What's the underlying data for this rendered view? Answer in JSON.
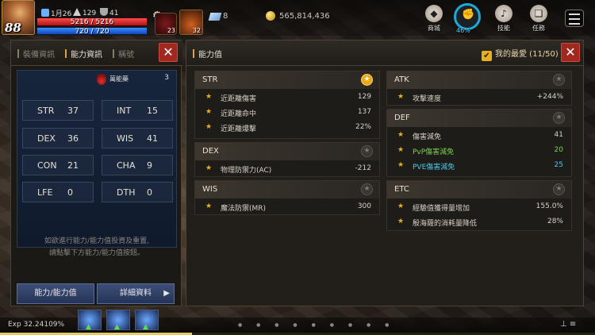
{
  "hud": {
    "level": "88",
    "hp_text": "5216 / 5216",
    "mp_text": "720 / 720",
    "stat_a": "1月26",
    "stat_b": "129",
    "stat_c": "41",
    "potion_count": "23",
    "skill_count": "32",
    "gem_count": "8",
    "gold": "565,814,436",
    "weight_pct": "46%",
    "menu": [
      {
        "icon": "bag-icon",
        "label": "商城"
      },
      {
        "icon": "fist-icon",
        "label": ""
      },
      {
        "icon": "skill-icon",
        "label": "技能"
      },
      {
        "icon": "quest-icon",
        "label": "任務"
      }
    ]
  },
  "left_panel": {
    "tabs": [
      "裝備資訊",
      "能力資訊",
      "稱號"
    ],
    "active_tab": "能力資訊",
    "elixir_label": "萬能藥",
    "elixir_value": "3",
    "stats": [
      {
        "k": "STR",
        "v": "37"
      },
      {
        "k": "INT",
        "v": "15"
      },
      {
        "k": "DEX",
        "v": "36"
      },
      {
        "k": "WIS",
        "v": "41"
      },
      {
        "k": "CON",
        "v": "21"
      },
      {
        "k": "CHA",
        "v": "9"
      },
      {
        "k": "LFE",
        "v": "0"
      },
      {
        "k": "DTH",
        "v": "0"
      }
    ],
    "hint_line1": "如欲進行能力/能力值投資及重置,",
    "hint_line2": "請點擊下方能力/能力值按鈕。",
    "btn_stats": "能力/能力值",
    "btn_detail": "詳細資料"
  },
  "right_panel": {
    "title": "能力值",
    "favorites": "我的最愛 (11/50)",
    "cards": {
      "str": {
        "title": "STR",
        "rows": [
          {
            "name": "近距離傷害",
            "value": "129"
          },
          {
            "name": "近距離命中",
            "value": "137"
          },
          {
            "name": "近距離爆擊",
            "value": "22%"
          }
        ]
      },
      "dex": {
        "title": "DEX",
        "rows": [
          {
            "name": "物理防禦力(AC)",
            "value": "-212"
          }
        ]
      },
      "wis": {
        "title": "WIS",
        "rows": [
          {
            "name": "魔法防禦(MR)",
            "value": "300"
          }
        ]
      },
      "atk": {
        "title": "ATK",
        "rows": [
          {
            "name": "攻擊速度",
            "value": "+244%"
          }
        ]
      },
      "def": {
        "title": "DEF",
        "rows": [
          {
            "name": "傷害減免",
            "value": "41"
          },
          {
            "name": "PvP傷害減免",
            "value": "20"
          },
          {
            "name": "PVE傷害減免",
            "value": "25"
          }
        ]
      },
      "etc": {
        "title": "ETC",
        "rows": [
          {
            "name": "經驗值獲得量增加",
            "value": "155.0%"
          },
          {
            "name": "殷海薩的消耗量降低",
            "value": "28%"
          }
        ]
      }
    }
  },
  "bottom": {
    "exp_text": "Exp 32.24109%",
    "exp_progress": 0.3224
  },
  "colors": {
    "accent_gold": "#e8b020",
    "pvp_green": "#7ad24a",
    "pve_cyan": "#4ac8e8",
    "close_red": "#a0281f"
  }
}
